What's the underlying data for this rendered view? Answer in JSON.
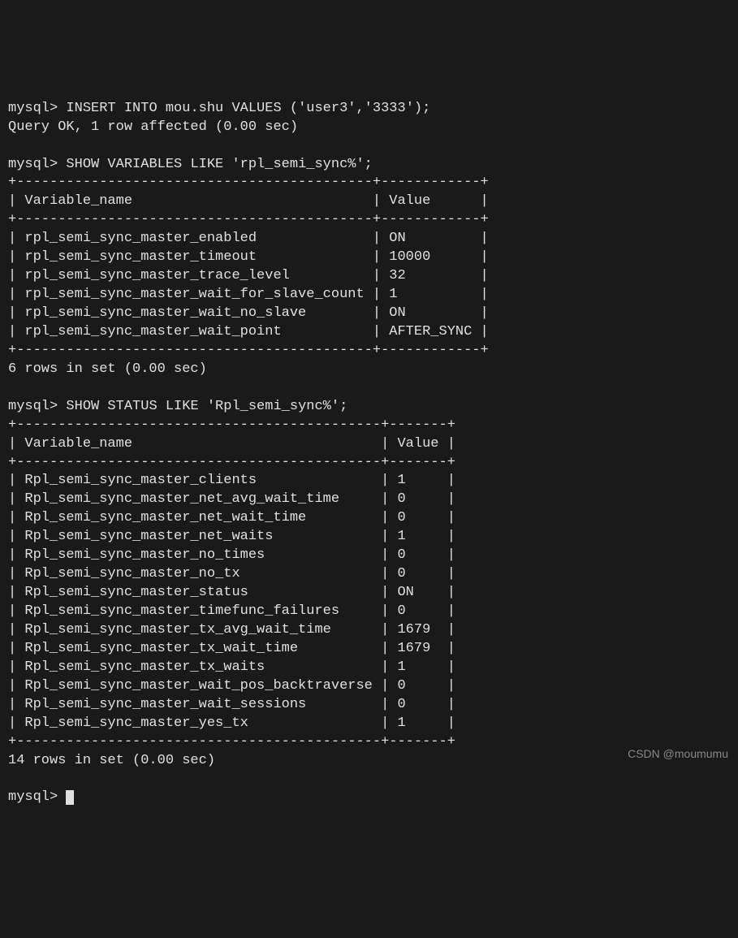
{
  "session": {
    "prompt": "mysql> ",
    "commands": {
      "insert": "INSERT INTO mou.shu VALUES ('user3','3333');",
      "insert_result": "Query OK, 1 row affected (0.00 sec)",
      "show_vars": "SHOW VARIABLES LIKE 'rpl_semi_sync%';",
      "show_status": "SHOW STATUS LIKE 'Rpl_semi_sync%';"
    }
  },
  "table1": {
    "border_top": "+-------------------------------------------+------------+",
    "header": "| Variable_name                             | Value      |",
    "border_header": "+-------------------------------------------+------------+",
    "rows": [
      "| rpl_semi_sync_master_enabled              | ON         |",
      "| rpl_semi_sync_master_timeout              | 10000      |",
      "| rpl_semi_sync_master_trace_level          | 32         |",
      "| rpl_semi_sync_master_wait_for_slave_count | 1          |",
      "| rpl_semi_sync_master_wait_no_slave        | ON         |",
      "| rpl_semi_sync_master_wait_point           | AFTER_SYNC |"
    ],
    "border_bottom": "+-------------------------------------------+------------+",
    "footer": "6 rows in set (0.00 sec)"
  },
  "table2": {
    "border_top": "+--------------------------------------------+-------+",
    "header": "| Variable_name                              | Value |",
    "border_header": "+--------------------------------------------+-------+",
    "rows": [
      "| Rpl_semi_sync_master_clients               | 1     |",
      "| Rpl_semi_sync_master_net_avg_wait_time     | 0     |",
      "| Rpl_semi_sync_master_net_wait_time         | 0     |",
      "| Rpl_semi_sync_master_net_waits             | 1     |",
      "| Rpl_semi_sync_master_no_times              | 0     |",
      "| Rpl_semi_sync_master_no_tx                 | 0     |",
      "| Rpl_semi_sync_master_status                | ON    |",
      "| Rpl_semi_sync_master_timefunc_failures     | 0     |",
      "| Rpl_semi_sync_master_tx_avg_wait_time      | 1679  |",
      "| Rpl_semi_sync_master_tx_wait_time          | 1679  |",
      "| Rpl_semi_sync_master_tx_waits              | 1     |",
      "| Rpl_semi_sync_master_wait_pos_backtraverse | 0     |",
      "| Rpl_semi_sync_master_wait_sessions         | 0     |",
      "| Rpl_semi_sync_master_yes_tx                | 1     |"
    ],
    "border_bottom": "+--------------------------------------------+-------+",
    "footer": "14 rows in set (0.00 sec)"
  },
  "watermark": "CSDN @moumumu"
}
